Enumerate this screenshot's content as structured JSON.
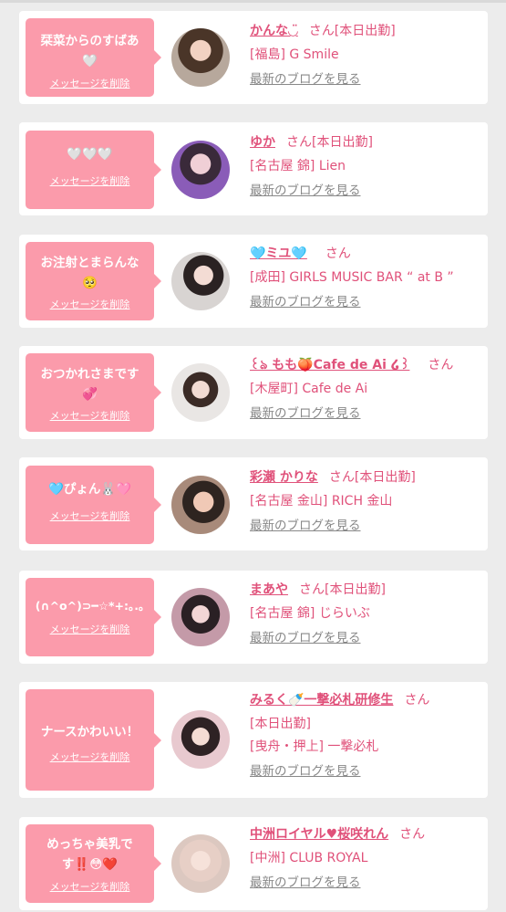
{
  "delete_label": "メッセージを削除",
  "blog_label": "最新のブログを見る",
  "san": "さん",
  "colors": {
    "bubble": "#fb9bab",
    "accent": "#e0517a",
    "link_gray": "#888888",
    "background": "#ececec"
  },
  "cards": [
    {
      "message": "栞菜からのすばあ\n🤍",
      "name": "かんな◡̈",
      "status": "[本日出勤]",
      "shop": "[福島] G Smile",
      "avatar": "avatar-photo"
    },
    {
      "message": "🤍🤍🤍",
      "name": "ゆか",
      "status": "[本日出勤]",
      "shop": "[名古屋 錦] Lien",
      "avatar": "avatar-photo"
    },
    {
      "message": "お注射とまらんな\n🥺",
      "name": "🩵ミユ🩵",
      "status": "",
      "shop": "[成田] GIRLS MUSIC BAR “ at B ”",
      "avatar": "avatar-photo"
    },
    {
      "message": "おつかれさまです\n💞",
      "name": "꒰ঌ もも🍑Cafe de Ai ໒꒱",
      "status": "",
      "shop": "[木屋町] Cafe de Ai",
      "avatar": "avatar-photo"
    },
    {
      "message": "🩵ぴょん🐰🩷",
      "name": "彩瀬 かりな",
      "status": "[本日出勤]",
      "shop": "[名古屋 金山] RICH 金山",
      "avatar": "avatar-photo"
    },
    {
      "message": "(∩^o^)⊃━☆*+:｡.｡",
      "name": "まあや",
      "status": "[本日出勤]",
      "shop": "[名古屋 錦] じらいぶ",
      "avatar": "avatar-photo"
    },
    {
      "message": "ナースかわいい！",
      "name": "みるく🍼一撃必札研修生",
      "status": "",
      "status_line": "[本日出勤]",
      "shop": "[曳舟・押上] 一撃必札",
      "avatar": "avatar-photo"
    },
    {
      "message": "めっちゃ美乳で\nす‼️😳❤️",
      "name": "中洲ロイヤル♥桜咲れん",
      "status": "",
      "shop": "[中洲] CLUB ROYAL",
      "avatar": "avatar-photo"
    }
  ]
}
